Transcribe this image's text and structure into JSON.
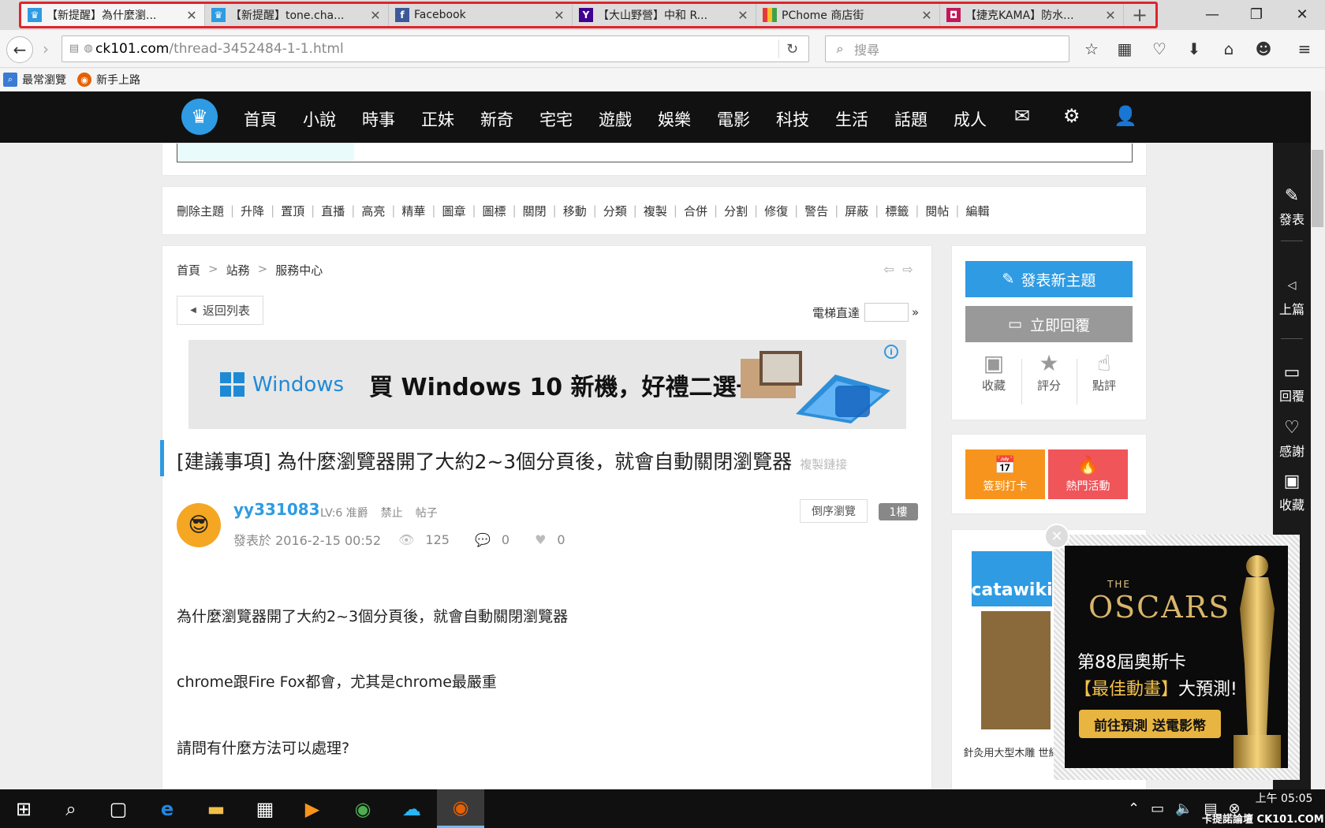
{
  "browser": {
    "tabs": [
      {
        "title": "【新提醒】為什麼瀏...",
        "favicon": "crown-icon",
        "color": "#2e9be3"
      },
      {
        "title": "【新提醒】tone.cha...",
        "favicon": "crown-icon",
        "color": "#2e9be3"
      },
      {
        "title": "Facebook",
        "favicon": "facebook-icon",
        "color": "#3b5998"
      },
      {
        "title": "【大山野營】中和 R...",
        "favicon": "yahoo-icon",
        "color": "#400090"
      },
      {
        "title": "PChome 商店街",
        "favicon": "pchome-icon",
        "color": "#e5b000"
      },
      {
        "title": "【捷克KAMA】防水...",
        "favicon": "bag-icon",
        "color": "#c2185b"
      }
    ],
    "new_tab": "+",
    "url_domain": "ck101.com",
    "url_path": "/thread-3452484-1-1.html",
    "search_placeholder": "搜尋",
    "bookmarks": [
      "最常瀏覽",
      "新手上路"
    ]
  },
  "site_nav": {
    "items": [
      "首頁",
      "小說",
      "時事",
      "正妹",
      "新奇",
      "宅宅",
      "遊戲",
      "娛樂",
      "電影",
      "科技",
      "生活",
      "話題",
      "成人"
    ]
  },
  "admin_actions": [
    "刪除主題",
    "升降",
    "置頂",
    "直播",
    "高亮",
    "精華",
    "圖章",
    "圖標",
    "關閉",
    "移動",
    "分類",
    "複製",
    "合併",
    "分割",
    "修復",
    "警告",
    "屏蔽",
    "標籤",
    "閱帖",
    "編輯"
  ],
  "breadcrumb": [
    "首頁",
    "站務",
    "服務中心"
  ],
  "back_to_list": "返回列表",
  "elevator_label": "電梯直達",
  "elevator_go": "»",
  "ad": {
    "brand": "Windows",
    "text": "買 Windows 10 新機，好禮二選一"
  },
  "thread": {
    "title": "[建議事項] 為什麼瀏覽器開了大約2~3個分頁後，就會自動關閉瀏覽器",
    "copy_link": "複製鏈接",
    "author": "yy331083",
    "level": "LV:6 准爵",
    "ban": "禁止",
    "posts": "帖子",
    "posted_at": "發表於 2016-2-15 00:52",
    "views": "125",
    "comments": "0",
    "likes": "0",
    "reverse_order": "倒序瀏覽",
    "floor": "1樓",
    "body": [
      "為什麼瀏覽器開了大約2~3個分頁後，就會自動關閉瀏覽器",
      "chrome跟Fire Fox都會，尤其是chrome最嚴重",
      "請問有什麼方法可以處理?"
    ]
  },
  "sidebar": {
    "new_topic": "發表新主題",
    "reply_now": "立即回覆",
    "mini": [
      "收藏",
      "評分",
      "點評"
    ],
    "checkin": "簽到打卡",
    "hot_events": "熱門活動",
    "catawiki_logo": "catawiki",
    "catawiki_caption": "針灸用大型木雕 世紀"
  },
  "right_bar": [
    "發表",
    "上篇",
    "回覆",
    "感謝",
    "收藏"
  ],
  "popup": {
    "the": "THE",
    "oscars": "OSCARS",
    "line1": "第88屆奧斯卡",
    "best": "【最佳動畫】",
    "predict": "大預測!",
    "button": "前往預測 送電影幣"
  },
  "taskbar": {
    "time": "上午 05:05",
    "watermark": "卡提諾論壇 CK101.COM"
  },
  "colors": {
    "accent": "#2e9be3",
    "checkin": "#f7941d",
    "hot": "#f0555a",
    "reply": "#999999"
  }
}
